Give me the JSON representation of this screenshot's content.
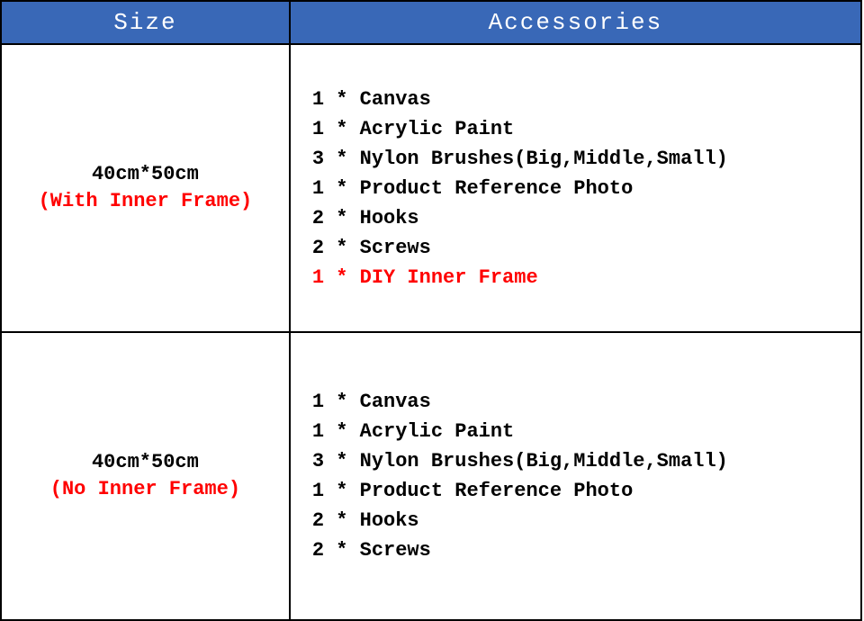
{
  "headers": {
    "size": "Size",
    "accessories": "Accessories"
  },
  "rows": [
    {
      "size_dim": "40cm*50cm",
      "size_note": "(With Inner Frame)",
      "items": [
        {
          "text": "1 * Canvas",
          "hl": false
        },
        {
          "text": "1 * Acrylic Paint",
          "hl": false
        },
        {
          "text": "3 * Nylon Brushes(Big,Middle,Small)",
          "hl": false
        },
        {
          "text": "1 * Product Reference Photo",
          "hl": false
        },
        {
          "text": "2 * Hooks",
          "hl": false
        },
        {
          "text": "2 * Screws",
          "hl": false
        },
        {
          "text": "1 * DIY Inner Frame",
          "hl": true
        }
      ]
    },
    {
      "size_dim": "40cm*50cm",
      "size_note": "(No Inner Frame)",
      "items": [
        {
          "text": "1 * Canvas",
          "hl": false
        },
        {
          "text": "1 * Acrylic Paint",
          "hl": false
        },
        {
          "text": "3 * Nylon Brushes(Big,Middle,Small)",
          "hl": false
        },
        {
          "text": "1 * Product Reference Photo",
          "hl": false
        },
        {
          "text": "2 * Hooks",
          "hl": false
        },
        {
          "text": "2 * Screws",
          "hl": false
        }
      ]
    }
  ]
}
